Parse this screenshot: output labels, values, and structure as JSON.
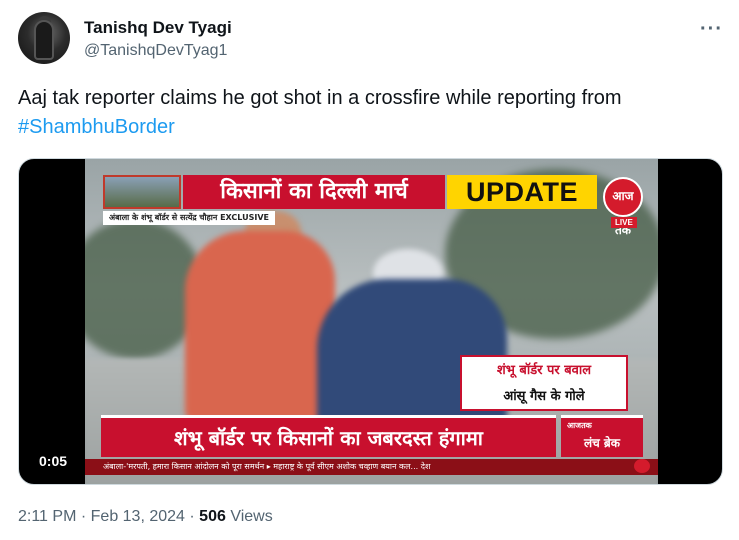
{
  "author": {
    "name": "Tanishq Dev Tyagi",
    "handle": "@TanishqDevTyag1"
  },
  "menu_icon": "more-horizontal-icon",
  "tweet": {
    "text": "Aaj tak reporter claims he got shot in a crossfire while reporting from",
    "hashtag": "#ShambhuBorder"
  },
  "video": {
    "timestamp": "0:05",
    "overlay": {
      "headline": "किसानों का दिल्ली मार्च",
      "update_label": "UPDATE",
      "logo_text": "आज तक",
      "live_label": "LIVE",
      "subline": "अंबाला के शंभू बॉर्डर से सत्येंद्र चौहान EXCLUSIVE",
      "side_line1": "शंभू बॉर्डर पर बवाल",
      "side_line2": "आंसू गैस के गोले",
      "lower_third": "शंभू बॉर्डर पर किसानों का जबरदस्त हंगामा",
      "lunch_logo": "आजतक",
      "lunch_break": "लंच ब्रेक",
      "ticker": "अंबाला-'मरपती, हमारा किसान आंदोलन को पूरा समर्थन ▸ महाराष्ट्र के पूर्व सीएम अशोक चव्हाण बयान कल... देश"
    }
  },
  "meta": {
    "time": "2:11 PM",
    "separator": "·",
    "date": "Feb 13, 2024",
    "views_count": "506",
    "views_label": "Views"
  }
}
